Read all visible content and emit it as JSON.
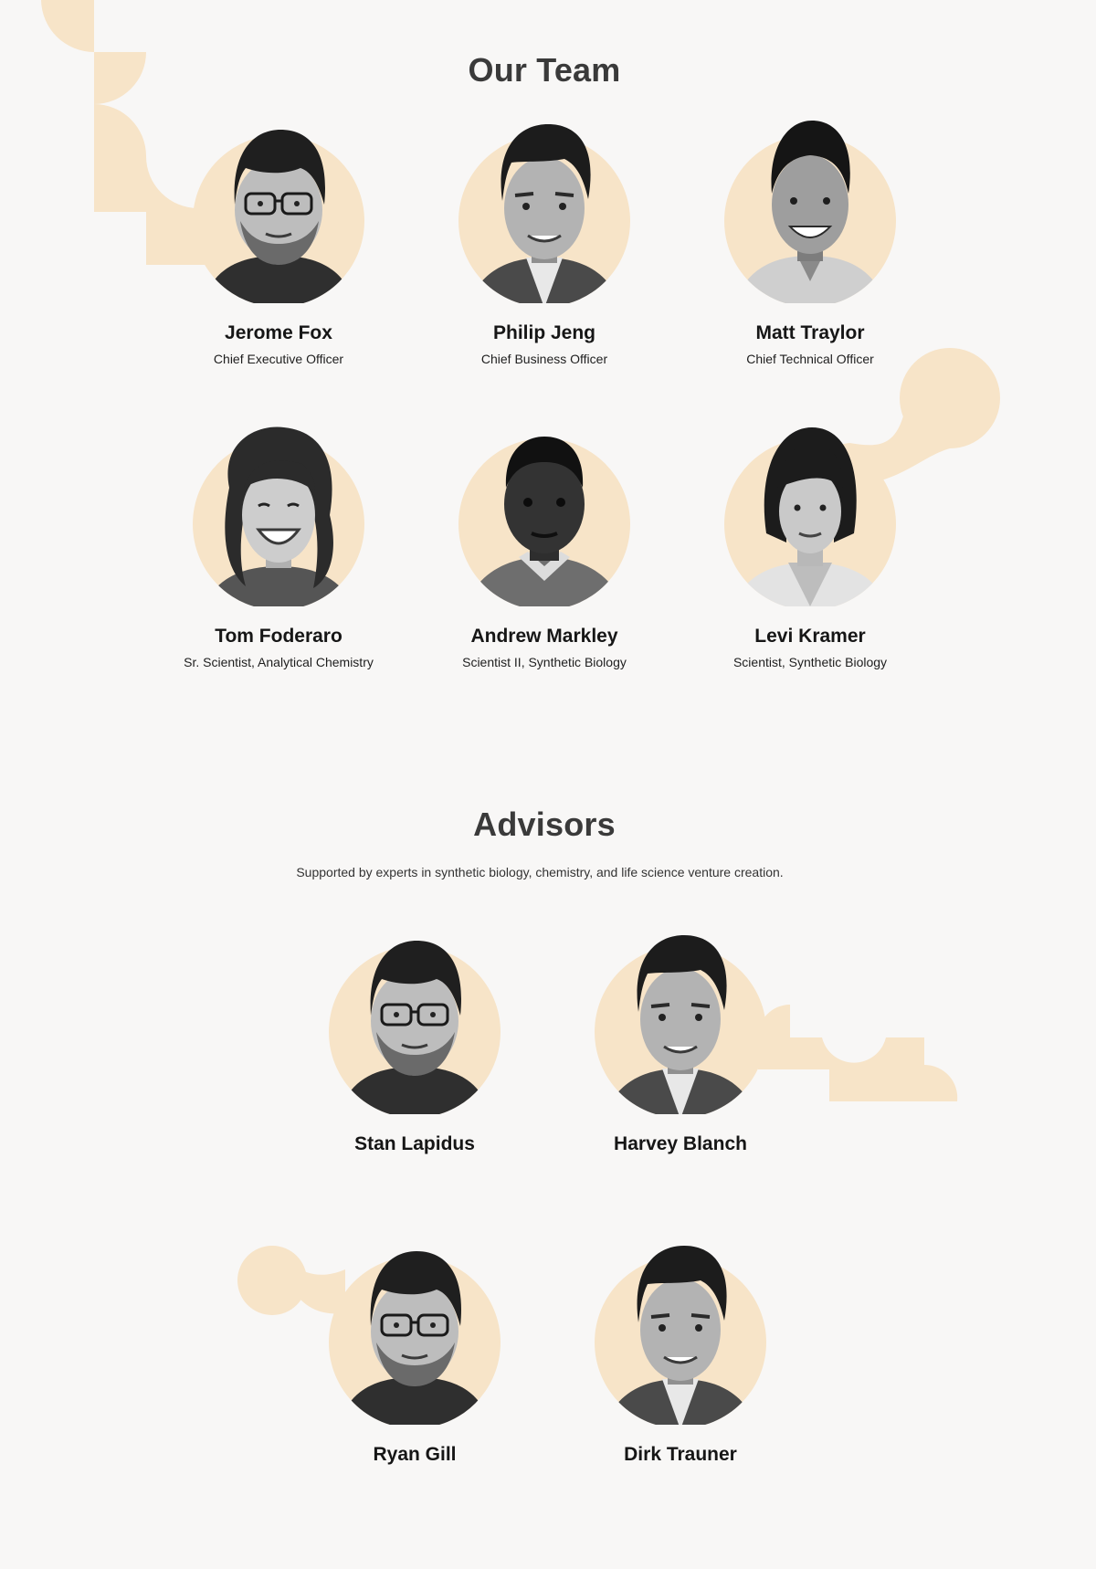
{
  "colors": {
    "background": "#f8f7f6",
    "accent": "#f7e4c8",
    "heading": "#3a3a3a",
    "text": "#161616"
  },
  "team": {
    "title": "Our Team",
    "members": [
      {
        "name": "Jerome Fox",
        "role": "Chief Executive Officer",
        "photo": "man-glasses-icon"
      },
      {
        "name": "Philip Jeng",
        "role": "Chief Business Officer",
        "photo": "man-smiling-icon"
      },
      {
        "name": "Matt Traylor",
        "role": "Chief Technical Officer",
        "photo": "man-grin-icon"
      },
      {
        "name": "Tom Foderaro",
        "role": "Sr. Scientist, Analytical Chemistry",
        "photo": "woman-wavy-hair-icon"
      },
      {
        "name": "Andrew Markley",
        "role": "Scientist II, Synthetic Biology",
        "photo": "man-sweater-icon"
      },
      {
        "name": "Levi Kramer",
        "role": "Scientist, Synthetic Biology",
        "photo": "woman-bob-hair-icon"
      }
    ]
  },
  "advisors": {
    "title": "Advisors",
    "subtitle": "Supported by experts in synthetic biology, chemistry, and life science venture creation.",
    "members": [
      {
        "name": "Stan Lapidus",
        "photo": "man-glasses-icon"
      },
      {
        "name": "Harvey Blanch",
        "photo": "man-smiling-icon"
      },
      {
        "name": "Ryan Gill",
        "photo": "man-glasses-icon"
      },
      {
        "name": "Dirk Trauner",
        "photo": "man-smiling-icon"
      }
    ]
  }
}
